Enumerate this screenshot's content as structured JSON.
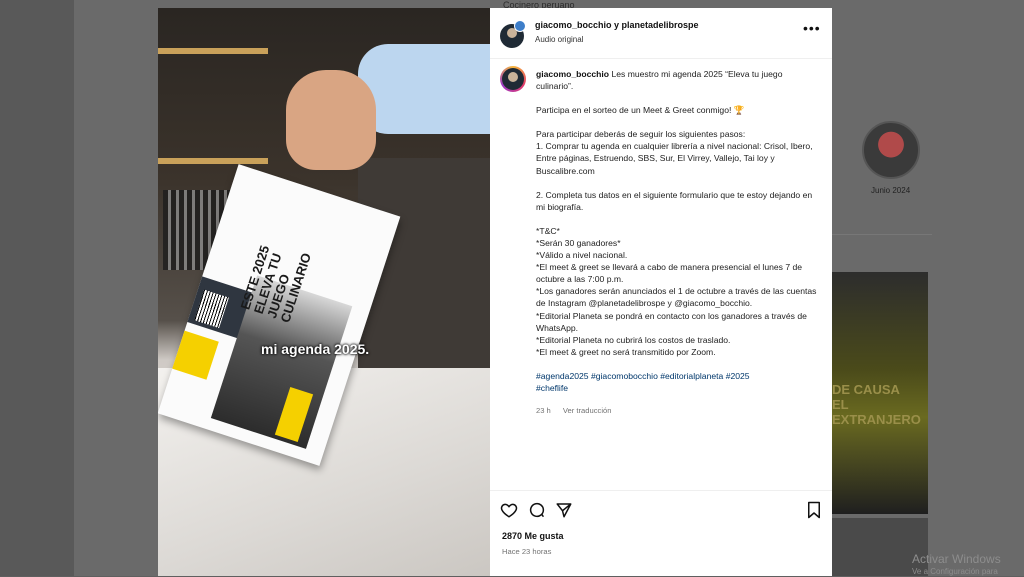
{
  "background": {
    "top_text": "Cocinero peruano",
    "profile_date_label": "Junio 2024",
    "thumbnail_text": "DE CAUSA\nEL EXTRANJERO",
    "windows_watermark": "Activar Windows",
    "windows_watermark_sub": "Ve a Configuración para"
  },
  "video": {
    "book_title": "ESTE 2025 ELEVA TU JUEGO CULINARIO",
    "caption": "mi agenda 2025."
  },
  "post": {
    "header": {
      "users": "giacomo_bocchio y planetadelibrospe",
      "audio": "Audio original",
      "more_icon": "more-horizontal-icon"
    },
    "caption": {
      "username": "giacomo_bocchio",
      "intro": " Les muestro mi agenda 2025 “Eleva tu juego culinario”.",
      "p1": "Participa en el sorteo de un Meet & Greet conmigo! 🏆",
      "p2": "Para participar deberás de seguir los siguientes pasos:\n1. Comprar tu agenda en cualquier librería a nivel nacional: Crisol, Ibero, Entre páginas, Estruendo, SBS, Sur, El Virrey, Vallejo, Tai loy y Buscalibre.com",
      "p3": "2. Completa tus datos en el siguiente formulario que te estoy dejando en mi biografía.",
      "p4": "*T&C*\n*Serán 30 ganadores*\n*Válido a nivel nacional.\n*El meet & greet se llevará a cabo de manera presencial el lunes 7 de octubre a las 7:00 p.m.\n*Los ganadores serán anunciados el 1 de octubre a través de las cuentas de Instagram @planetadelibrospe y @giacomo_bocchio.\n*Editorial Planeta se pondrá en contacto con los ganadores a través de WhatsApp.\n*Editorial Planeta no cubrirá los costos de traslado.\n*El meet & greet no será transmitido por Zoom.",
      "hashtags": "#agenda2025 #giacomobocchio #editorialplaneta #2025\n#cheflife"
    },
    "meta": {
      "time": "23 h",
      "translate": "Ver traducción"
    },
    "actions": {
      "like_icon": "heart-icon",
      "comment_icon": "comment-icon",
      "share_icon": "send-icon",
      "save_icon": "bookmark-icon"
    },
    "likes": "2870 Me gusta",
    "posted": "Hace 23 horas"
  }
}
